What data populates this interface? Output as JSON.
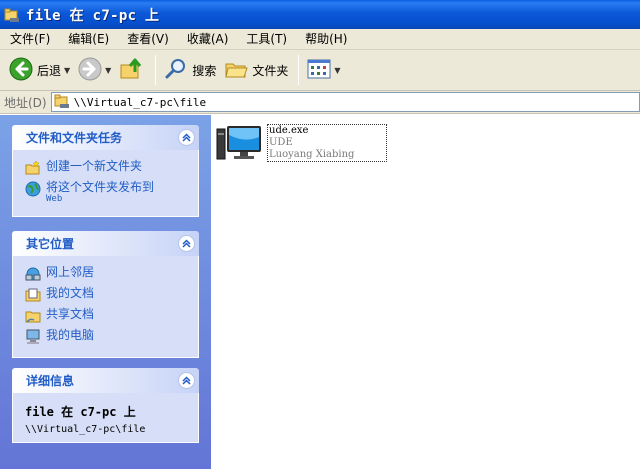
{
  "window": {
    "title": "file 在 c7-pc 上"
  },
  "menu": [
    {
      "label": "文件(F)"
    },
    {
      "label": "编辑(E)"
    },
    {
      "label": "查看(V)"
    },
    {
      "label": "收藏(A)"
    },
    {
      "label": "工具(T)"
    },
    {
      "label": "帮助(H)"
    }
  ],
  "toolbar": {
    "back_label": "后退",
    "search_label": "搜索",
    "folders_label": "文件夹"
  },
  "address": {
    "label": "地址(D)",
    "value": "\\\\Virtual_c7-pc\\file"
  },
  "tasks_panel": {
    "title": "文件和文件夹任务",
    "items": [
      {
        "label": "创建一个新文件夹",
        "sub": ""
      },
      {
        "label": "将这个文件夹发布到",
        "sub": "Web"
      }
    ]
  },
  "places_panel": {
    "title": "其它位置",
    "items": [
      {
        "label": "网上邻居"
      },
      {
        "label": "我的文档"
      },
      {
        "label": "共享文档"
      },
      {
        "label": "我的电脑"
      }
    ]
  },
  "details_panel": {
    "title": "详细信息",
    "name": "file 在 c7-pc 上",
    "path": "\\\\Virtual_c7-pc\\file"
  },
  "files": [
    {
      "name": "ude.exe",
      "description": "UDE",
      "company": "Luoyang Xiabing"
    }
  ]
}
